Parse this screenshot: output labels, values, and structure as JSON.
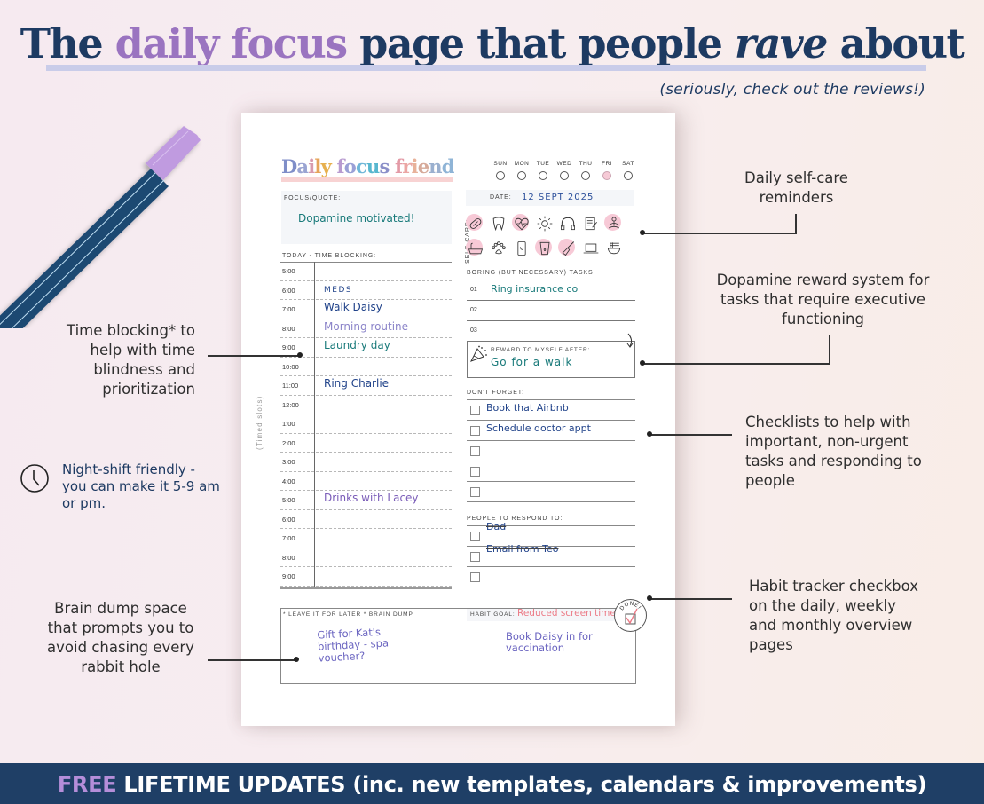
{
  "headline": {
    "part1": "The ",
    "highlight": "daily focus",
    "part2": " page that people ",
    "emphasis": "rave",
    "part3": " about",
    "subtitle": "(seriously, check out the reviews!)"
  },
  "planner": {
    "title_letters": [
      {
        "ch": "D",
        "color": "#7f8ec8"
      },
      {
        "ch": "a",
        "color": "#9aa4d2"
      },
      {
        "ch": "i",
        "color": "#d89aae"
      },
      {
        "ch": "l",
        "color": "#e6a45a"
      },
      {
        "ch": "y",
        "color": "#e7b04e"
      },
      {
        "ch": " ",
        "color": "#000"
      },
      {
        "ch": "f",
        "color": "#b89bd0"
      },
      {
        "ch": "o",
        "color": "#9aa0d6"
      },
      {
        "ch": "c",
        "color": "#6fb7d8"
      },
      {
        "ch": "u",
        "color": "#58b7cf"
      },
      {
        "ch": "s",
        "color": "#8a8fc8"
      },
      {
        "ch": " ",
        "color": "#000"
      },
      {
        "ch": "f",
        "color": "#e39aa6"
      },
      {
        "ch": "r",
        "color": "#eba6a4"
      },
      {
        "ch": "i",
        "color": "#e8b29a"
      },
      {
        "ch": "e",
        "color": "#d6aa9a"
      },
      {
        "ch": "n",
        "color": "#9ab0cf"
      },
      {
        "ch": "d",
        "color": "#8fb4d6"
      }
    ],
    "focus_label": "Focus/Quote:",
    "focus_value": "Dopamine motivated!",
    "days": [
      {
        "name": "SUN",
        "selected": false
      },
      {
        "name": "MON",
        "selected": false
      },
      {
        "name": "TUE",
        "selected": false
      },
      {
        "name": "WED",
        "selected": false
      },
      {
        "name": "THU",
        "selected": false
      },
      {
        "name": "FRI",
        "selected": true
      },
      {
        "name": "SAT",
        "selected": false
      }
    ],
    "date_label": "Date:",
    "date_value": "12 SEPT 2025",
    "self_care_label": "Self-care:",
    "self_care_icons": [
      {
        "name": "pill",
        "checked": true
      },
      {
        "name": "tooth",
        "checked": false
      },
      {
        "name": "heart-pulse",
        "checked": true
      },
      {
        "name": "sun",
        "checked": false
      },
      {
        "name": "headphones",
        "checked": false
      },
      {
        "name": "journal",
        "checked": false
      },
      {
        "name": "meditation",
        "checked": true
      },
      {
        "name": "bath",
        "checked": true
      },
      {
        "name": "paw",
        "checked": false
      },
      {
        "name": "phone",
        "checked": false
      },
      {
        "name": "water-glass",
        "checked": true
      },
      {
        "name": "broom",
        "checked": true
      },
      {
        "name": "laptop",
        "checked": false
      },
      {
        "name": "noodle-bowl",
        "checked": false
      }
    ],
    "time_blocking_label": "Today - Time blocking:",
    "timed_slots_label": "(Timed slots)",
    "time_slots": [
      {
        "time": "5:00",
        "entry": "",
        "color": ""
      },
      {
        "time": "6:00",
        "entry": "MEDS",
        "color": "#21438a"
      },
      {
        "time": "7:00",
        "entry": "Walk Daisy",
        "color": "#21438a"
      },
      {
        "time": "8:00",
        "entry": "Morning routine",
        "color": "#8b84c9"
      },
      {
        "time": "9:00",
        "entry": "Laundry day",
        "color": "#197a7a"
      },
      {
        "time": "10:00",
        "entry": "",
        "color": ""
      },
      {
        "time": "11:00",
        "entry": "Ring Charlie",
        "color": "#21438a"
      },
      {
        "time": "12:00",
        "entry": "",
        "color": ""
      },
      {
        "time": "1:00",
        "entry": "",
        "color": ""
      },
      {
        "time": "2:00",
        "entry": "",
        "color": ""
      },
      {
        "time": "3:00",
        "entry": "",
        "color": ""
      },
      {
        "time": "4:00",
        "entry": "",
        "color": ""
      },
      {
        "time": "5:00",
        "entry": "Drinks with Lacey",
        "color": "#7a5cb8"
      },
      {
        "time": "6:00",
        "entry": "",
        "color": ""
      },
      {
        "time": "7:00",
        "entry": "",
        "color": ""
      },
      {
        "time": "8:00",
        "entry": "",
        "color": ""
      },
      {
        "time": "9:00",
        "entry": "",
        "color": ""
      }
    ],
    "boring_tasks_label": "Boring (but necessary) tasks:",
    "boring_tasks": [
      {
        "num": "01",
        "text": "Ring insurance co"
      },
      {
        "num": "02",
        "text": ""
      },
      {
        "num": "03",
        "text": ""
      }
    ],
    "reward_label": "Reward to myself after:",
    "reward_value": "Go for a walk",
    "dont_forget_label": "Don't forget:",
    "dont_forget": [
      {
        "text": "Book that Airbnb",
        "checked": false
      },
      {
        "text": "Schedule doctor appt",
        "checked": false
      },
      {
        "text": "",
        "checked": false
      },
      {
        "text": "",
        "checked": false
      },
      {
        "text": "",
        "checked": false
      }
    ],
    "people_label": "People to respond to:",
    "people": [
      {
        "text": "Dad",
        "done": true
      },
      {
        "text": "Email from Teo",
        "done": true
      },
      {
        "text": "",
        "done": false
      }
    ],
    "brain_dump_label": "* Leave it for later * brain dump",
    "brain_dump_notes": [
      "Gift for Kat's birthday - spa voucher?",
      "Book Daisy in for vaccination"
    ],
    "habit_goal_label": "Habit goal:",
    "habit_goal_value": "Reduced screen time",
    "done_badge": "DONE!",
    "habit_done": true
  },
  "annotations": {
    "self_care": "Daily self-care reminders",
    "dopamine": "Dopamine reward system for tasks that require executive functioning",
    "time_blocking": "Time blocking* to help with time blindness and prioritization",
    "night_shift": "Night-shift friendly - you can make it 5-9 am or pm.",
    "checklists": "Checklists to help with important, non-urgent tasks and responding to people",
    "habit": "Habit tracker checkbox on the daily, weekly and monthly overview pages",
    "brain_dump": "Brain dump space that prompts you to avoid chasing every rabbit hole"
  },
  "footer": {
    "free": "FREE",
    "rest": " LIFETIME UPDATES (inc. new templates, calendars & improvements)"
  },
  "colors": {
    "navy": "#1d3a62",
    "purple": "#9a74c0",
    "footer_bg": "#1f3f66",
    "pink_check": "#f7c9d6",
    "habit_red": "#ec7a86"
  }
}
